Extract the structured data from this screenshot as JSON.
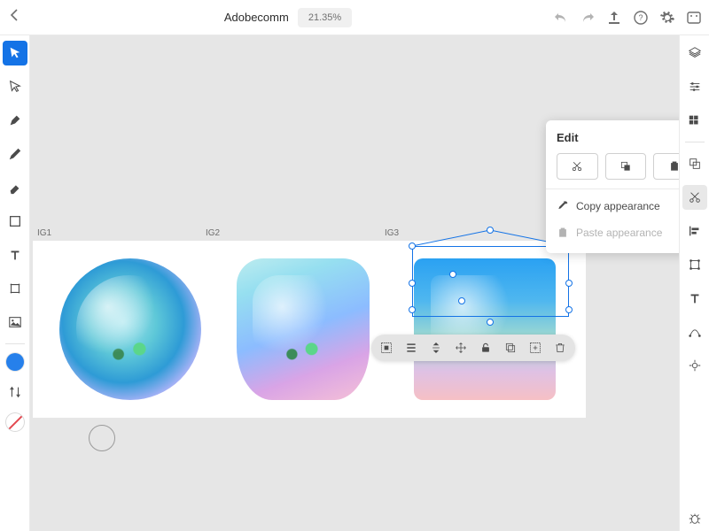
{
  "header": {
    "title": "Adobecomm",
    "zoom": "21.35%"
  },
  "artboards": [
    "IG1",
    "IG2",
    "IG3"
  ],
  "edit_popover": {
    "title": "Edit",
    "copy_appearance": "Copy appearance",
    "paste_appearance": "Paste appearance"
  },
  "colors": {
    "accent": "#1473e6"
  }
}
